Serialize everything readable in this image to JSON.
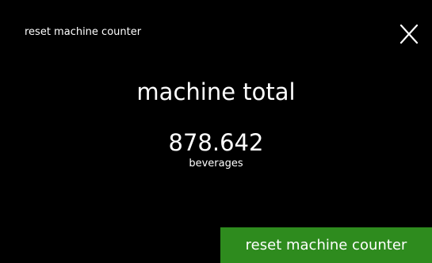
{
  "header": {
    "title": "reset machine counter",
    "close_icon": "close-icon"
  },
  "counter": {
    "heading": "machine total",
    "value": "878.642",
    "unit": "beverages"
  },
  "actions": {
    "reset_label": "reset machine counter"
  },
  "colors": {
    "background": "#000000",
    "text": "#ffffff",
    "accent_green": "#2e8b1e"
  }
}
